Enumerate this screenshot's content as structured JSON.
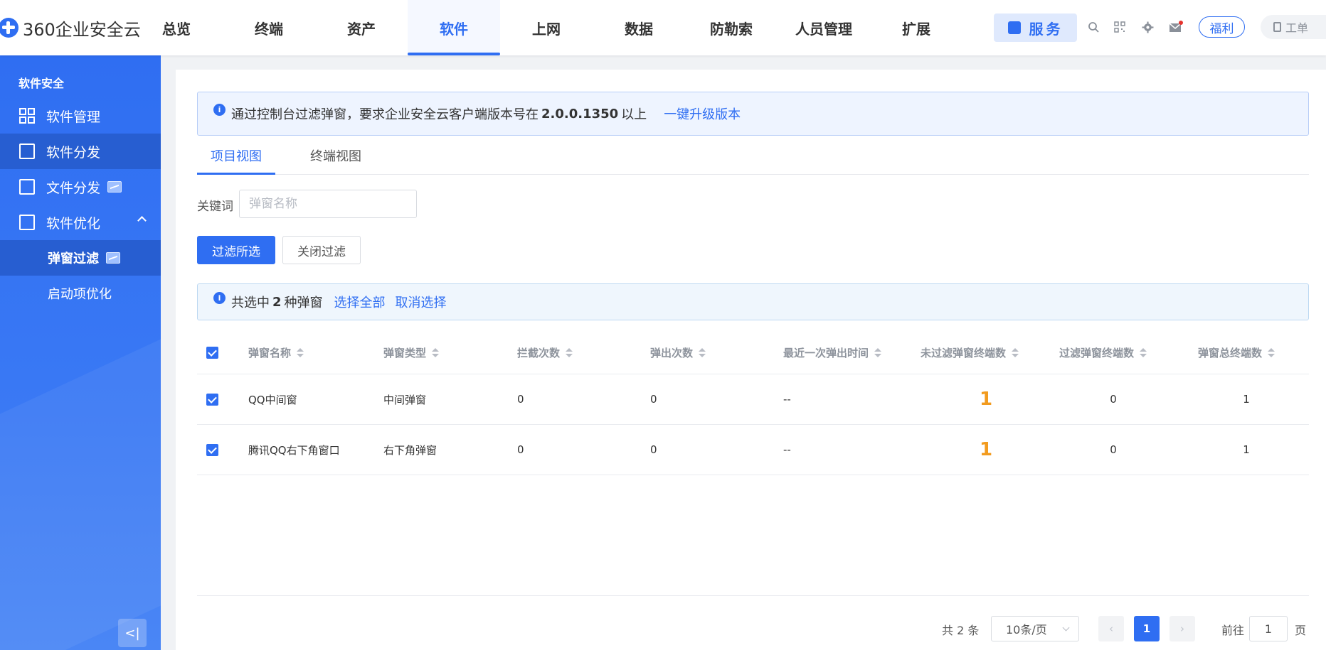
{
  "app": {
    "logo_text": "360企业安全云"
  },
  "nav": {
    "items": [
      {
        "label": "总览"
      },
      {
        "label": "终端"
      },
      {
        "label": "资产"
      },
      {
        "label": "软件"
      },
      {
        "label": "上网"
      },
      {
        "label": "数据"
      },
      {
        "label": "防勒索"
      },
      {
        "label": "人员管理"
      },
      {
        "label": "扩展"
      }
    ],
    "active": "软件",
    "service_label": "服务",
    "fuli_label": "福利",
    "ticket_label": "工单"
  },
  "sidebar": {
    "section_title": "软件安全",
    "items": [
      {
        "label": "软件管理"
      },
      {
        "label": "软件分发"
      },
      {
        "label": "文件分发"
      },
      {
        "label": "软件优化"
      }
    ],
    "sub_items": [
      {
        "label": "弹窗过滤"
      },
      {
        "label": "启动项优化"
      }
    ],
    "collapse_label": "<|"
  },
  "notice": {
    "text_before": "通过控制台过滤弹窗，要求企业安全云客户端版本号在",
    "version": "2.0.0.1350",
    "text_after": "以上",
    "link": "一键升级版本"
  },
  "tabs": [
    {
      "label": "项目视图"
    },
    {
      "label": "终端视图"
    }
  ],
  "filter": {
    "keyword_label": "关键词",
    "keyword_placeholder": "弹窗名称",
    "keyword_value": ""
  },
  "buttons": {
    "filter_selected": "过滤所选",
    "close_filter": "关闭过滤"
  },
  "selection": {
    "prefix": "共选中",
    "count": "2",
    "suffix": "种弹窗",
    "select_all": "选择全部",
    "cancel": "取消选择"
  },
  "table": {
    "columns": [
      "弹窗名称",
      "弹窗类型",
      "拦截次数",
      "弹出次数",
      "最近一次弹出时间",
      "未过滤弹窗终端数",
      "过滤弹窗终端数",
      "弹窗总终端数"
    ],
    "rows": [
      {
        "name": "QQ中间窗",
        "type": "中间弹窗",
        "blocked": "0",
        "popped": "0",
        "last_time": "--",
        "unfiltered": "1",
        "filtered": "0",
        "total": "1"
      },
      {
        "name": "腾讯QQ右下角窗口",
        "type": "右下角弹窗",
        "blocked": "0",
        "popped": "0",
        "last_time": "--",
        "unfiltered": "1",
        "filtered": "0",
        "total": "1"
      }
    ]
  },
  "pagination": {
    "total_text": "共 2 条",
    "page_size": "10条/页",
    "current_page": "1",
    "goto_prefix": "前往",
    "goto_value": "1",
    "goto_suffix": "页"
  },
  "colors": {
    "primary": "#2f6ef2",
    "highlight_number": "#f29b1e"
  }
}
